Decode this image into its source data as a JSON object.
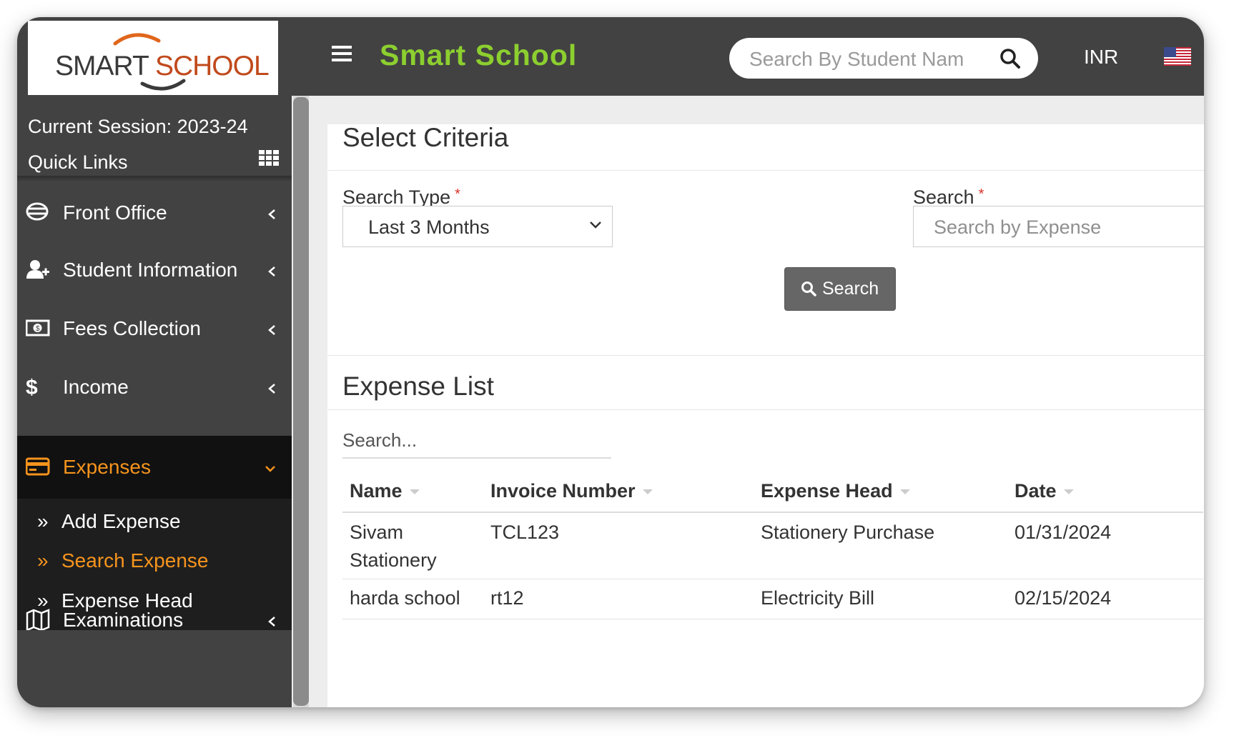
{
  "header": {
    "logo_part1": "SMART",
    "logo_part2": "SCHOOL",
    "app_title": "Smart School",
    "search_placeholder": "Search By Student Nam",
    "currency": "INR"
  },
  "sidebar": {
    "session": "Current Session: 2023-24",
    "quick_links": "Quick Links",
    "items": [
      {
        "label": "Front Office",
        "icon": "ticket-icon"
      },
      {
        "label": "Student Information",
        "icon": "user-plus-icon"
      },
      {
        "label": "Fees Collection",
        "icon": "money-icon"
      },
      {
        "label": "Income",
        "icon": "dollar-icon"
      },
      {
        "label": "Expenses",
        "icon": "credit-card-icon"
      },
      {
        "label": "Examinations",
        "icon": "map-icon"
      }
    ],
    "sub_items": [
      {
        "label": "Add Expense"
      },
      {
        "label": "Search Expense"
      },
      {
        "label": "Expense Head"
      }
    ]
  },
  "criteria": {
    "title": "Select Criteria",
    "search_type_label": "Search Type",
    "search_type_value": "Last 3 Months",
    "search_label": "Search",
    "search_placeholder": "Search by Expense",
    "button_label": "Search"
  },
  "expense_list": {
    "title": "Expense List",
    "search_placeholder": "Search...",
    "columns": [
      "Name",
      "Invoice Number",
      "Expense Head",
      "Date"
    ],
    "rows": [
      {
        "name_line1": "Sivam",
        "name_line2": "Stationery",
        "invoice": "TCL123",
        "head": "Stationery Purchase",
        "date": "01/31/2024"
      },
      {
        "name_line1": "harda school",
        "name_line2": "",
        "invoice": "rt12",
        "head": "Electricity Bill",
        "date": "02/15/2024"
      }
    ]
  },
  "colors": {
    "accent_green": "#8ccf2f",
    "accent_orange": "#f7941d",
    "topbar": "#424242"
  }
}
